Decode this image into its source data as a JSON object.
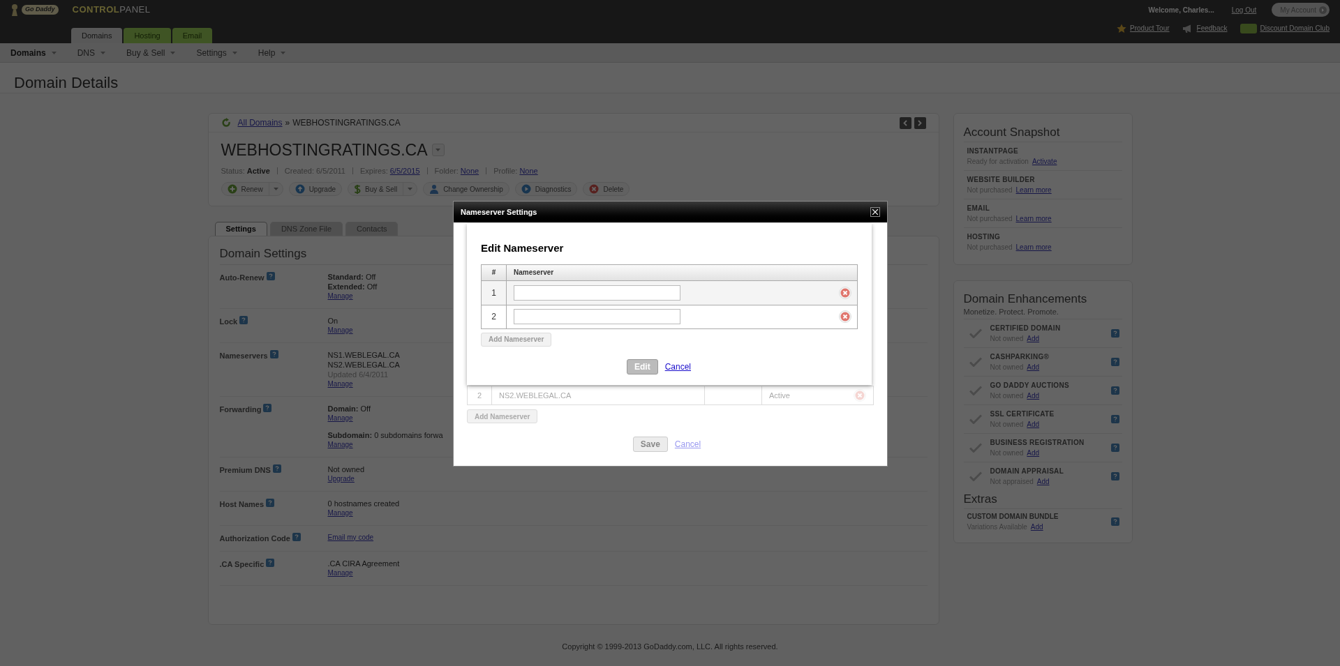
{
  "header": {
    "brand": "Go Daddy",
    "product": {
      "highlight": "CONTROL",
      "rest": "PANEL"
    },
    "welcome": "Welcome, Charles...",
    "logout": "Log Out",
    "account_button": "My Account"
  },
  "app_tabs": [
    {
      "label": "Domains",
      "selected": true
    },
    {
      "label": "Hosting",
      "selected": false
    },
    {
      "label": "Email",
      "selected": false
    }
  ],
  "top_links": [
    {
      "kind": "star",
      "label": "Product Tour"
    },
    {
      "kind": "megaphone",
      "label": "Feedback"
    },
    {
      "kind": "badge",
      "label": "Discount Domain Club"
    }
  ],
  "nav_menu": [
    {
      "label": "Domains",
      "selected": true
    },
    {
      "label": "DNS",
      "selected": false
    },
    {
      "label": "Buy & Sell",
      "selected": false
    },
    {
      "label": "Settings",
      "selected": false
    },
    {
      "label": "Help",
      "selected": false
    }
  ],
  "page_title": "Domain Details",
  "domain_card": {
    "breadcrumb": {
      "link": "All Domains",
      "separator": "»",
      "current": "WEBHOSTINGRATINGS.CA"
    },
    "domain_name": "WEBHOSTINGRATINGS.CA",
    "meta": [
      {
        "label": "Status:",
        "value": "Active",
        "kind": "bold"
      },
      {
        "label": "Created:",
        "value": "6/5/2011",
        "kind": "plain"
      },
      {
        "label": "Expires:",
        "value": "6/5/2015",
        "kind": "link"
      },
      {
        "label": "Folder:",
        "value": "None",
        "kind": "link"
      },
      {
        "label": "Profile:",
        "value": "None",
        "kind": "link"
      }
    ],
    "actions": [
      {
        "label": "Renew",
        "kind": "plus",
        "split": true
      },
      {
        "label": "Upgrade",
        "kind": "up",
        "split": false
      },
      {
        "label": "Buy & Sell",
        "kind": "dollar",
        "split": true
      },
      {
        "label": "Change Ownership",
        "kind": "person",
        "split": false
      },
      {
        "label": "Diagnostics",
        "kind": "play",
        "split": false
      },
      {
        "label": "Delete",
        "kind": "delete",
        "split": false
      }
    ]
  },
  "settings_tabs": [
    {
      "label": "Settings",
      "selected": true
    },
    {
      "label": "DNS Zone File",
      "selected": false
    },
    {
      "label": "Contacts",
      "selected": false
    }
  ],
  "domain_settings": {
    "title": "Domain Settings",
    "rows": [
      {
        "label": "Auto-Renew",
        "groups": [
          [
            {
              "kind": "pair",
              "label": "Standard:",
              "value": "Off"
            },
            {
              "kind": "pair",
              "label": "Extended:",
              "value": "Off"
            },
            {
              "kind": "link",
              "text": "Manage"
            }
          ]
        ]
      },
      {
        "label": "Lock",
        "groups": [
          [
            {
              "kind": "text",
              "text": "On"
            },
            {
              "kind": "link",
              "text": "Manage"
            }
          ]
        ]
      },
      {
        "label": "Nameservers",
        "groups": [
          [
            {
              "kind": "text",
              "text": "NS1.WEBLEGAL.CA"
            },
            {
              "kind": "text",
              "text": "NS2.WEBLEGAL.CA"
            },
            {
              "kind": "muted",
              "text": "Updated 6/4/2011"
            },
            {
              "kind": "link",
              "text": "Manage"
            }
          ]
        ]
      },
      {
        "label": "Forwarding",
        "groups": [
          [
            {
              "kind": "pair",
              "label": "Domain:",
              "value": "Off"
            },
            {
              "kind": "link",
              "text": "Manage"
            }
          ],
          [
            {
              "kind": "pair",
              "label": "Subdomain:",
              "value": "0 subdomains forwa"
            },
            {
              "kind": "link",
              "text": "Manage"
            }
          ]
        ]
      },
      {
        "label": "Premium DNS",
        "groups": [
          [
            {
              "kind": "text",
              "text": "Not owned"
            },
            {
              "kind": "link",
              "text": "Upgrade"
            }
          ]
        ]
      },
      {
        "label": "Host Names",
        "groups": [
          [
            {
              "kind": "text",
              "text": "0 hostnames created"
            },
            {
              "kind": "link",
              "text": "Manage"
            }
          ]
        ]
      },
      {
        "label": "Authorization Code",
        "groups": [
          [
            {
              "kind": "link",
              "text": "Email my code"
            }
          ]
        ]
      },
      {
        "label": ".CA Specific",
        "groups": [
          [
            {
              "kind": "text",
              "text": ".CA CIRA Agreement"
            },
            {
              "kind": "link",
              "text": "Manage"
            }
          ]
        ]
      }
    ]
  },
  "account_snapshot": {
    "title": "Account Snapshot",
    "items": [
      {
        "name": "INSTANTPAGE",
        "status": "Ready for activation",
        "link": "Activate"
      },
      {
        "name": "WEBSITE BUILDER",
        "status": "Not purchased",
        "link": "Learn more"
      },
      {
        "name": "EMAIL",
        "status": "Not purchased",
        "link": "Learn more"
      },
      {
        "name": "HOSTING",
        "status": "Not purchased",
        "link": "Learn more"
      }
    ]
  },
  "domain_enhancements": {
    "title": "Domain Enhancements",
    "subtitle": "Monetize. Protect. Promote.",
    "items": [
      {
        "name": "CERTIFIED DOMAIN",
        "status": "Not owned",
        "link": "Add"
      },
      {
        "name": "CASHPARKING®",
        "status": "Not owned",
        "link": "Add"
      },
      {
        "name": "GO DADDY AUCTIONS",
        "status": "Not owned",
        "link": "Add"
      },
      {
        "name": "SSL CERTIFICATE",
        "status": "Not owned",
        "link": "Add"
      },
      {
        "name": "BUSINESS REGISTRATION",
        "status": "Not owned",
        "link": "Add"
      },
      {
        "name": "DOMAIN APPRAISAL",
        "status": "Not appraised",
        "link": "Add"
      }
    ],
    "extras_title": "Extras",
    "extras": [
      {
        "name": "CUSTOM DOMAIN BUNDLE",
        "status": "Variations Available",
        "link": "Add"
      }
    ]
  },
  "footer": "Copyright © 1999-2013 GoDaddy.com, LLC. All rights reserved.",
  "modal": {
    "title": "Nameserver Settings",
    "rows": [
      {
        "number": "2",
        "name": "NS2.WEBLEGAL.CA",
        "status": "Active"
      }
    ],
    "add_button": "Add Nameserver",
    "save_button": "Save",
    "cancel_link": "Cancel",
    "popup": {
      "title": "Edit Nameserver",
      "columns": [
        "#",
        "Nameserver"
      ],
      "rows": [
        {
          "number": "1"
        },
        {
          "number": "2"
        }
      ],
      "add_button": "Add Nameserver",
      "edit_button": "Edit",
      "cancel_link": "Cancel"
    }
  }
}
